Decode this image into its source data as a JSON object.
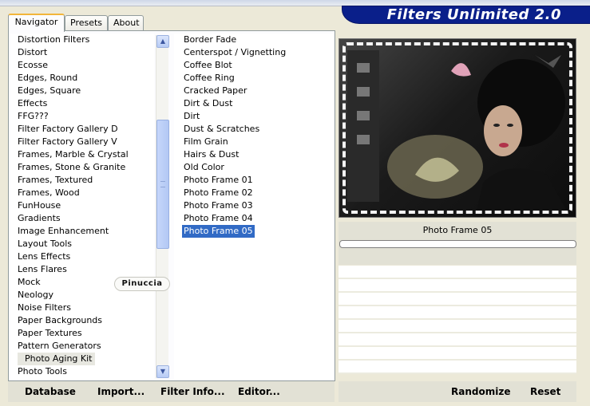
{
  "window": {
    "title": "Filters Unlimited 2.0"
  },
  "tabs": [
    {
      "label": "Navigator",
      "active": true
    },
    {
      "label": "Presets",
      "active": false
    },
    {
      "label": "About",
      "active": false
    }
  ],
  "categories": {
    "items": [
      "Distortion Filters",
      "Distort",
      "Ecosse",
      "Edges, Round",
      "Edges, Square",
      "Effects",
      "FFG???",
      "Filter Factory Gallery D",
      "Filter Factory Gallery V",
      "Frames, Marble & Crystal",
      "Frames, Stone & Granite",
      "Frames, Textured",
      "Frames, Wood",
      "FunHouse",
      "Gradients",
      "Image Enhancement",
      "Layout Tools",
      "Lens Effects",
      "Lens Flares",
      "Mock",
      "Neology",
      "Noise Filters",
      "Paper Backgrounds",
      "Paper Textures",
      "Pattern Generators",
      "Photo Aging Kit",
      "Photo Tools"
    ],
    "selected": "Photo Aging Kit"
  },
  "watermark": "Pinuccia",
  "filters": {
    "items": [
      "Border Fade",
      "Centerspot / Vignetting",
      "Coffee Blot",
      "Coffee Ring",
      "Cracked Paper",
      "Dirt & Dust",
      "Dirt",
      "Dust & Scratches",
      "Film Grain",
      "Hairs & Dust",
      "Old Color",
      "Photo Frame 01",
      "Photo Frame 02",
      "Photo Frame 03",
      "Photo Frame 04",
      "Photo Frame 05"
    ],
    "selected": "Photo Frame 05"
  },
  "preview": {
    "filter_name": "Photo Frame 05",
    "progress": 0
  },
  "buttons": {
    "database": "Database",
    "import": "Import...",
    "filter_info": "Filter Info...",
    "editor": "Editor...",
    "randomize": "Randomize",
    "reset": "Reset"
  },
  "colors": {
    "title_bar": "#0a1f8a",
    "selection": "#316ac5",
    "scroll_thumb": "#b3c8f4"
  }
}
